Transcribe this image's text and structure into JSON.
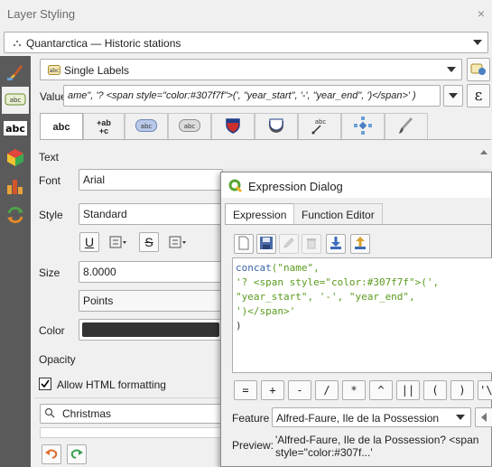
{
  "window": {
    "title": "Layer Styling",
    "close_glyph": "×"
  },
  "layer": {
    "name": "Quantarctica — Historic stations"
  },
  "label_mode": {
    "value": "Single Labels"
  },
  "value_row": {
    "label": "Value",
    "expression": "ame\",  '? <span style=\"color:#307f7f\">(',  \"year_start\", '-', \"year_end\",  ')</span>' )",
    "epsilon": "ε"
  },
  "left_panel": {
    "items": [
      "paintbrush-icon",
      "labels-icon",
      "abc-icon",
      "3d-box-icon",
      "diagrams-icon",
      "history-icon"
    ]
  },
  "tabs": {
    "items": [
      "text-tab",
      "formatting-tab",
      "buffer-tab",
      "mask-tab",
      "background-tab",
      "shadow-tab",
      "callouts-tab",
      "placement-tab",
      "rendering-tab"
    ],
    "text_label": "abc",
    "format_label_top": "+ab",
    "format_label_bottom": "+c"
  },
  "text_section": {
    "header": "Text",
    "font_label": "Font",
    "font_value": "Arial",
    "style_label": "Style",
    "style_value": "Standard",
    "size_label": "Size",
    "size_value": "8.0000",
    "unit_value": "Points",
    "color_label": "Color",
    "color_hex": "#333333",
    "opacity_label": "Opacity",
    "html_label": "Allow HTML formatting",
    "html_checked": true,
    "underline_glyph": "U",
    "strike_glyph": "S"
  },
  "bottom": {
    "preview_value": "Christmas"
  },
  "dialog": {
    "title": "Expression Dialog",
    "tab_expression": "Expression",
    "tab_function_editor": "Function Editor",
    "code": {
      "line1_fn": "concat",
      "line1_rest": "(\"name\",",
      "line2": "'? <span style=\"color:#307f7f\">(',",
      "line3": "\"year_start\", '-', \"year_end\",",
      "line4": "')</span>'",
      "line5": ")"
    },
    "operators": [
      "=",
      "+",
      "-",
      "/",
      "*",
      "^",
      "||",
      "(",
      ")",
      "'\\n"
    ],
    "feature_label": "Feature",
    "feature_value": "Alfred-Faure, Ile de la Possession",
    "preview_label": "Preview:",
    "preview_line1": "'Alfred-Faure, Ile de la Possession? <span",
    "preview_line2": "style=\"color:#307f...'"
  }
}
